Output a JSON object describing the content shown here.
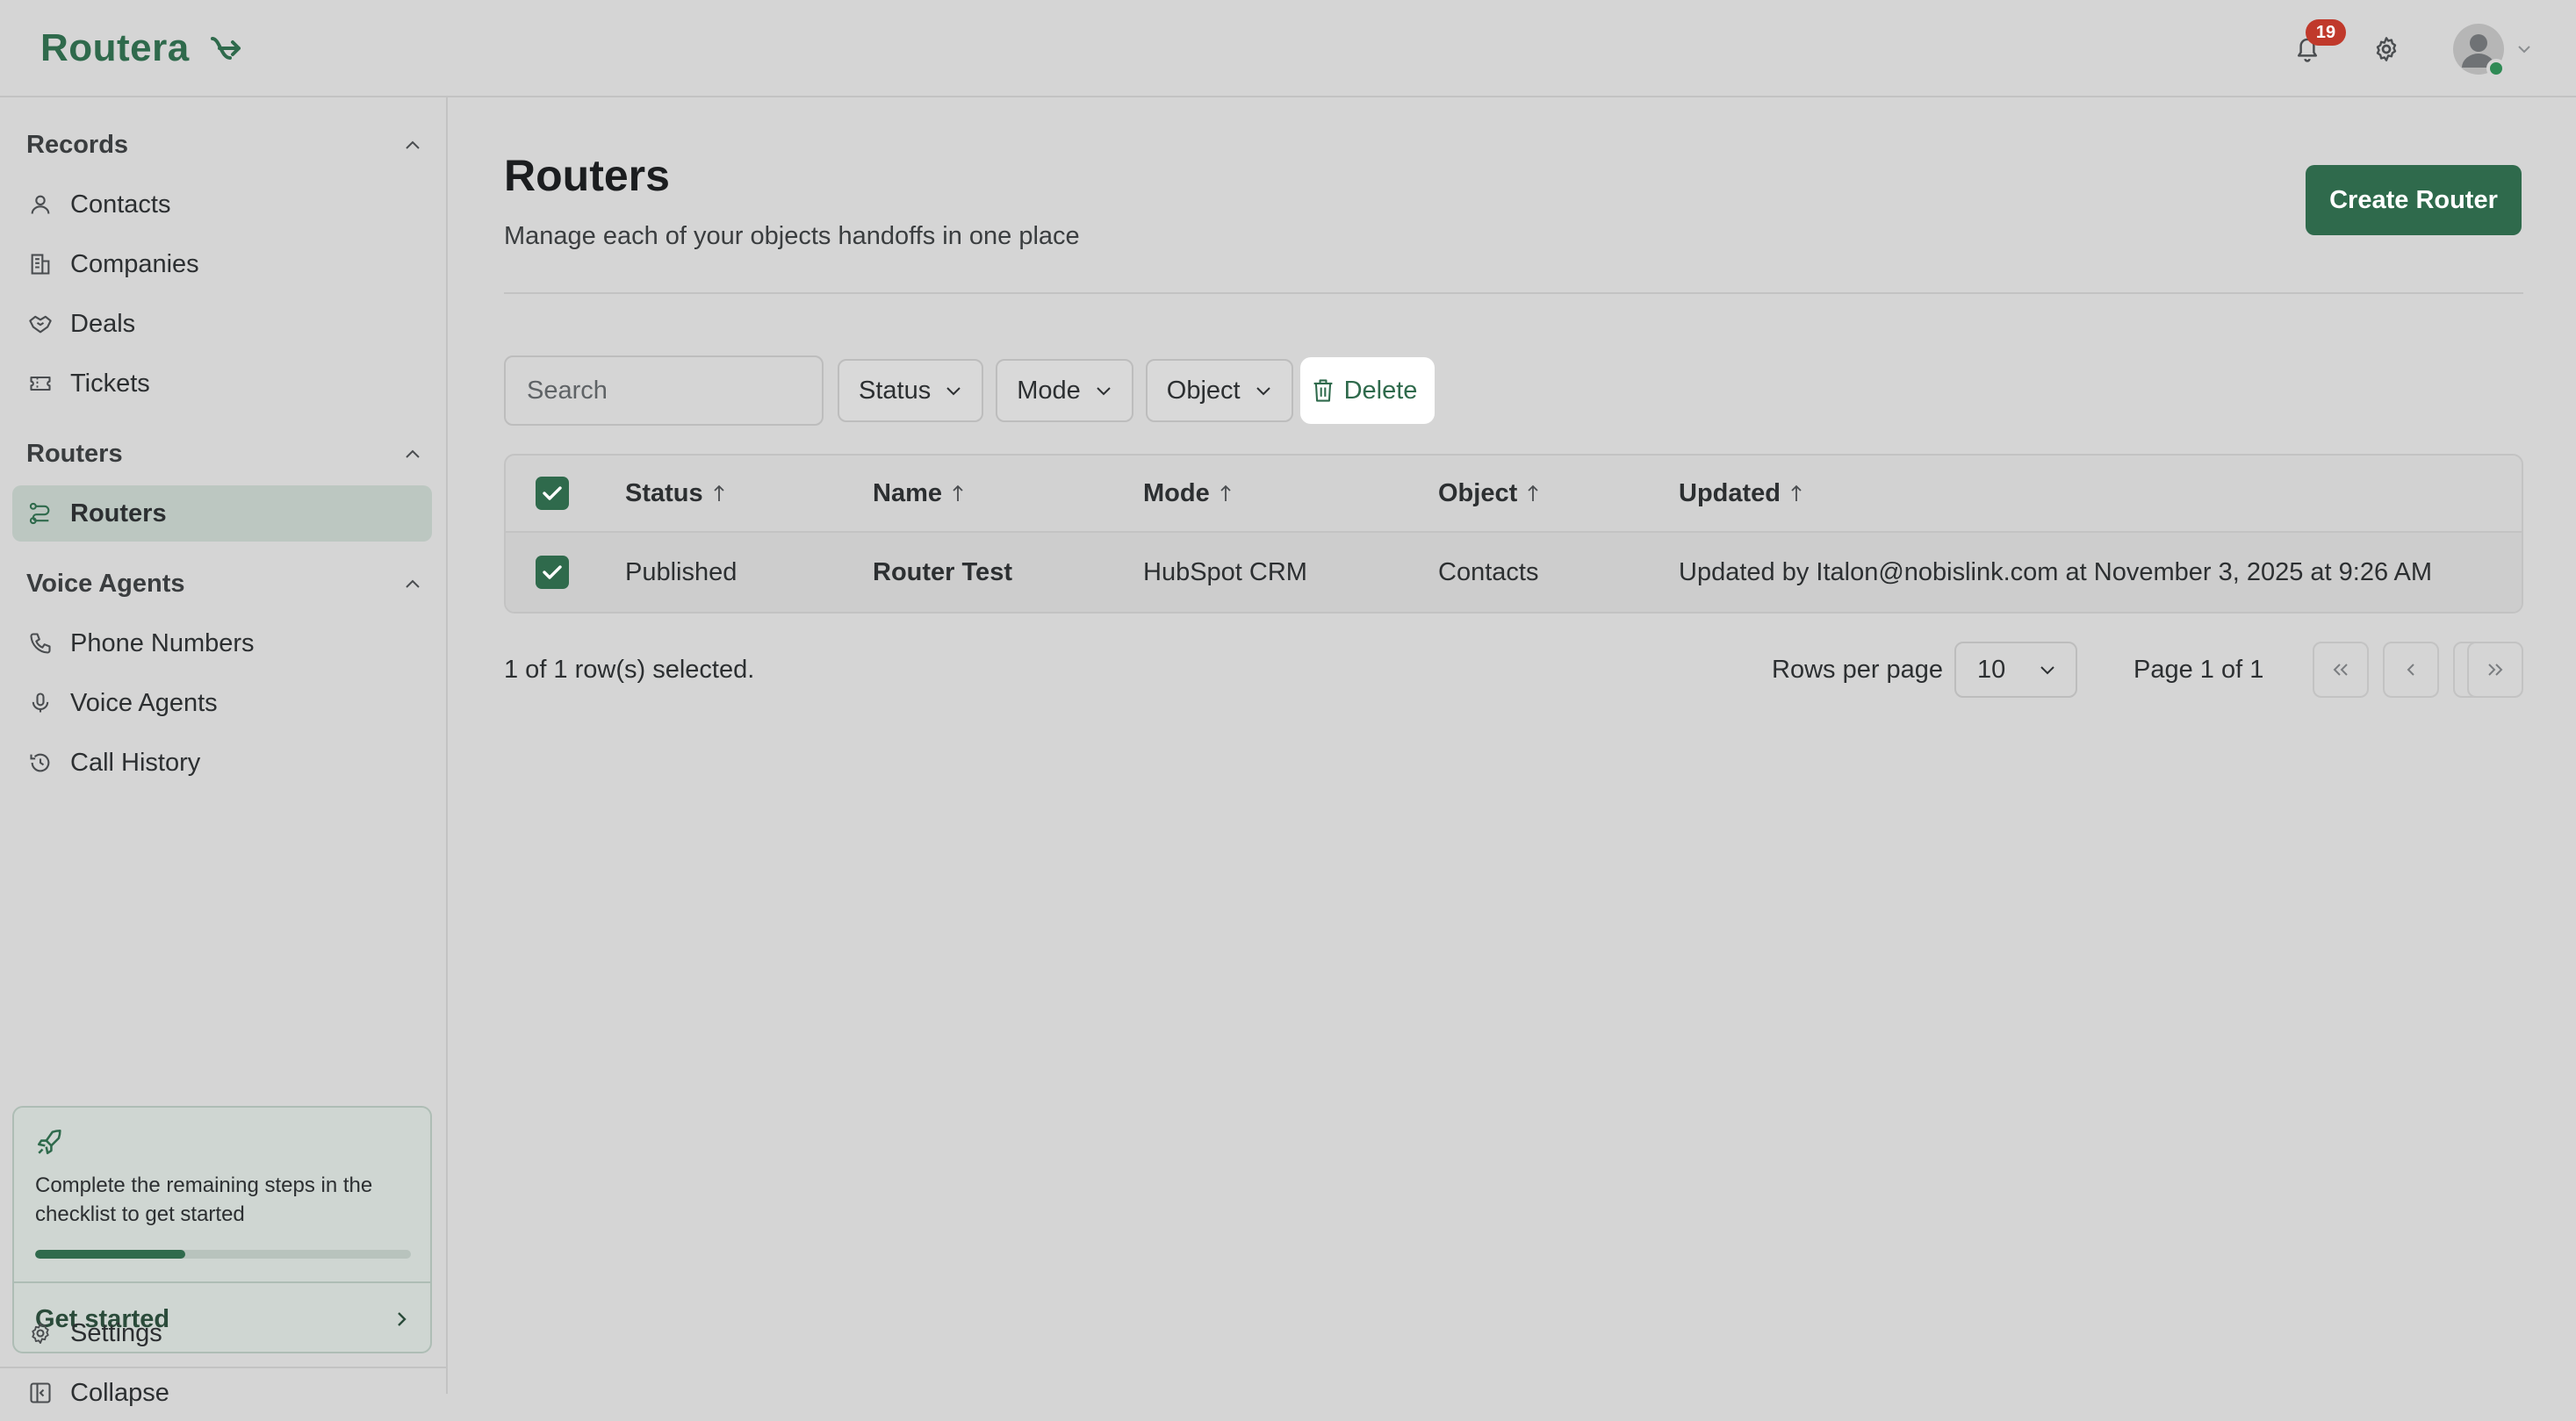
{
  "app": {
    "logo_text": "Routera",
    "notifications_count": "19"
  },
  "sidebar": {
    "sections": {
      "records": "Records",
      "routers": "Routers",
      "voice_agents": "Voice Agents"
    },
    "items": {
      "contacts": "Contacts",
      "companies": "Companies",
      "deals": "Deals",
      "tickets": "Tickets",
      "routers": "Routers",
      "phone_numbers": "Phone Numbers",
      "voice_agents": "Voice Agents",
      "call_history": "Call History",
      "settings": "Settings",
      "collapse": "Collapse"
    },
    "active_item": "Routers",
    "checklist": {
      "text": "Complete the remaining steps in the checklist to get started",
      "progress_percent": 40,
      "cta": "Get started"
    }
  },
  "main": {
    "title": "Routers",
    "subtitle": "Manage each of your objects handoffs in one place",
    "create_button": "Create Router",
    "toolbar": {
      "search_placeholder": "Search",
      "filters": [
        "Status",
        "Mode",
        "Object"
      ],
      "delete_label": "Delete"
    },
    "table": {
      "columns": [
        "Status",
        "Name",
        "Mode",
        "Object",
        "Updated"
      ],
      "rows": [
        {
          "selected": true,
          "status": "Published",
          "name": "Router Test",
          "mode": "HubSpot CRM",
          "object": "Contacts",
          "updated": "Updated by Italon@nobislink.com at November 3, 2025 at 9:26 AM"
        }
      ],
      "all_selected": true
    },
    "footer": {
      "selected_text": "1 of 1 row(s) selected.",
      "rows_per_page_label": "Rows per page",
      "rows_per_page_value": "10",
      "page_info": "Page 1 of 1"
    }
  },
  "colors": {
    "brand": "#2f6a4c",
    "background": "#d5d5d5",
    "badge": "#c0392b"
  }
}
